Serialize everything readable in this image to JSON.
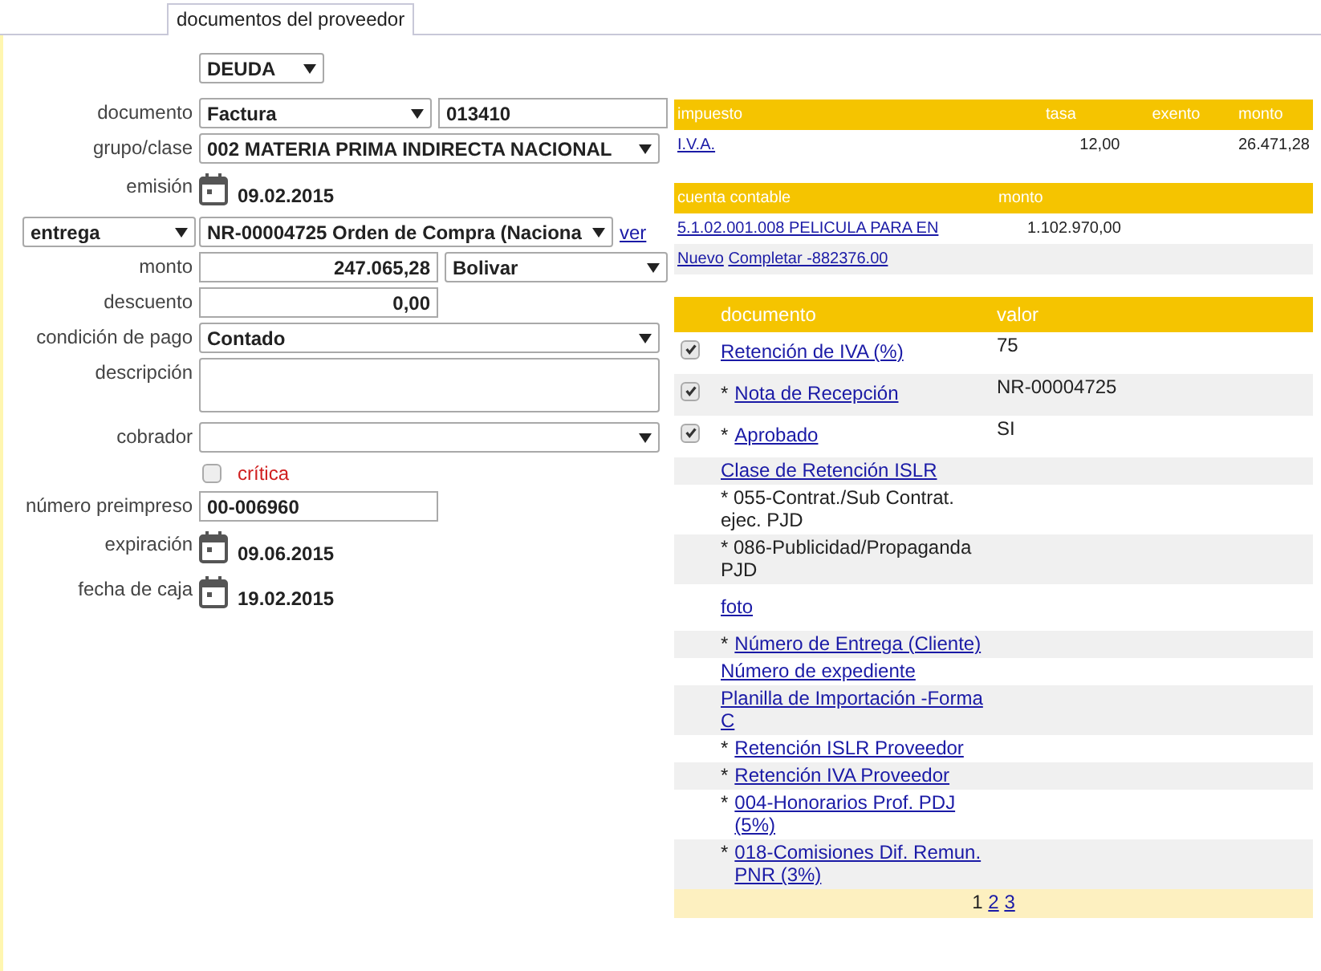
{
  "tab": {
    "label": "documentos del proveedor",
    "selected": true
  },
  "form": {
    "type": "DEUDA",
    "rows": [
      {
        "kind": "select_input",
        "label": "documento",
        "value": "Factura",
        "extra": "013410"
      },
      {
        "kind": "select",
        "label": "grupo/clase",
        "value": "002 MATERIA PRIMA INDIRECTA NACIONAL"
      },
      {
        "kind": "date",
        "label": "emisión",
        "value": "09.02.2015"
      },
      {
        "kind": "link_select",
        "label": "entrega",
        "value": "NR-00004725 Orden de Compra (Naciona",
        "link": "ver"
      },
      {
        "kind": "amount_select",
        "label": "monto",
        "value": "247.065,28",
        "extra": "Bolivar"
      },
      {
        "kind": "amount",
        "label": "descuento",
        "value": "0,00"
      },
      {
        "kind": "select",
        "label": "condición de pago",
        "value": "Contado"
      },
      {
        "kind": "textarea",
        "label": "descripción"
      },
      {
        "kind": "select",
        "label": "cobrador"
      },
      {
        "kind": "checkbox",
        "label": "crítica",
        "checked": false
      },
      {
        "kind": "input",
        "label": "número preimpreso",
        "value": "00-006960"
      },
      {
        "kind": "date",
        "label": "expiración",
        "value": "09.06.2015"
      },
      {
        "kind": "date",
        "label": "fecha de caja",
        "value": "19.02.2015"
      }
    ]
  },
  "taxes": {
    "columns": [
      "impuesto",
      "tasa",
      "exento",
      "monto"
    ],
    "rows": [
      {
        "name": "I.V.A.",
        "tasa": "12,00",
        "monto": "26.471,28"
      }
    ]
  },
  "accounts": {
    "columns": [
      "cuenta contable",
      "monto"
    ],
    "rows": [
      {
        "account": "5.1.02.001.008 PELICULA PARA EN",
        "monto": "1.102.970,00"
      }
    ],
    "links": [
      "Nuevo",
      "Completar -882376.00"
    ]
  },
  "documents": {
    "columns": [
      "documento",
      "valor"
    ],
    "rows": [
      {
        "kind": "check",
        "checked": true,
        "label": "Retención de IVA (%)",
        "value": "75"
      },
      {
        "kind": "check",
        "checked": true,
        "prefix": "*",
        "label": "Nota de Recepción",
        "value": "NR-00004725"
      },
      {
        "kind": "check",
        "checked": true,
        "prefix": "*",
        "label": "Aprobado",
        "value": "SI"
      },
      {
        "kind": "link",
        "label": "Clase de Retención ISLR"
      },
      {
        "kind": "text",
        "label": "* 055-Contrat./Sub Contrat. ejec. PJD"
      },
      {
        "kind": "text",
        "label": "* 086-Publicidad/Propaganda PJD"
      },
      {
        "kind": "photo",
        "label": "foto"
      },
      {
        "kind": "link",
        "prefix": "*",
        "label": "Número de Entrega (Cliente)"
      },
      {
        "kind": "link",
        "label": "Número de expediente"
      },
      {
        "kind": "link",
        "label": "Planilla de Importación -Forma C"
      },
      {
        "kind": "link",
        "prefix": "*",
        "label": "Retención ISLR Proveedor"
      },
      {
        "kind": "link",
        "prefix": "*",
        "label": "Retención IVA Proveedor"
      },
      {
        "kind": "link",
        "prefix": "*",
        "label": "004-Honorarios Prof. PDJ (5%)"
      },
      {
        "kind": "link",
        "prefix": "*",
        "label": "018-Comisiones Dif. Remun. PNR (3%)"
      }
    ],
    "pages": [
      {
        "label": "1",
        "selected": true
      },
      {
        "label": "2",
        "selected": false
      },
      {
        "label": "3",
        "selected": false
      }
    ]
  }
}
